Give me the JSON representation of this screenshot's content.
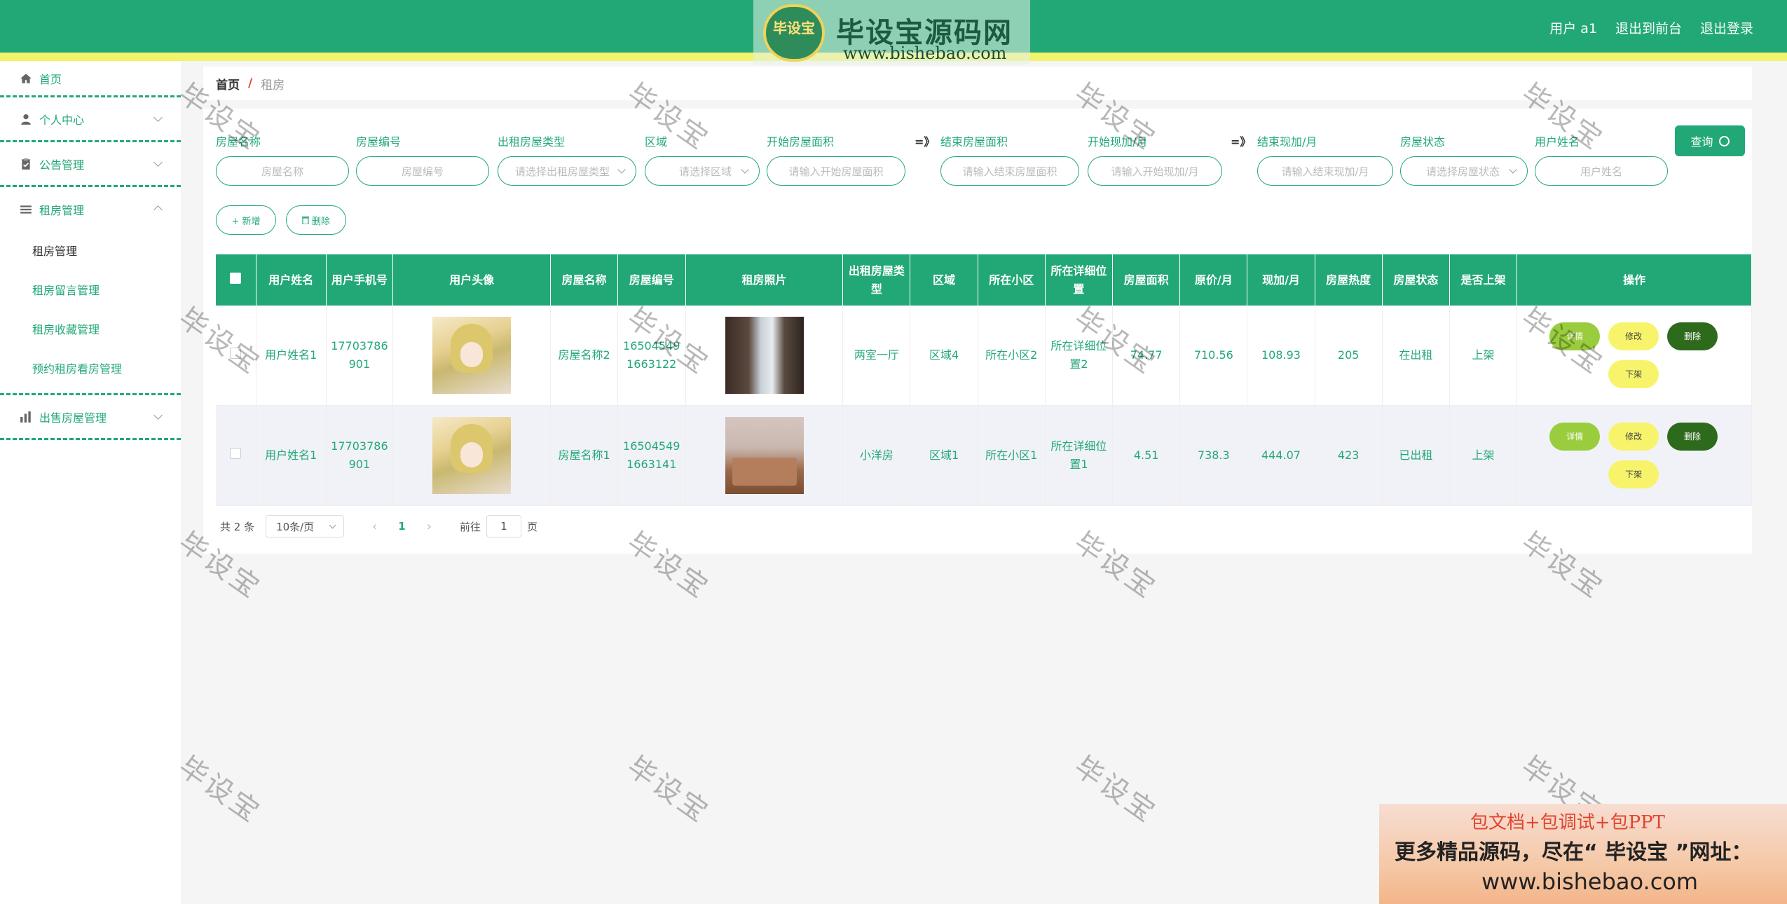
{
  "header": {
    "logo_badge": "毕设宝",
    "logo_title": "毕设宝源码网",
    "logo_url": "www.bishebao.com",
    "user": "用户 a1",
    "back_to_front": "退出到前台",
    "logout": "退出登录"
  },
  "sidebar": {
    "items": [
      {
        "label": "首页",
        "icon": "home-icon"
      },
      {
        "label": "个人中心",
        "icon": "user-icon"
      },
      {
        "label": "公告管理",
        "icon": "clipboard-icon"
      },
      {
        "label": "租房管理",
        "icon": "list-icon"
      },
      {
        "label": "出售房屋管理",
        "icon": "bar-chart-icon"
      }
    ],
    "sub": [
      "租房管理",
      "租房留言管理",
      "租房收藏管理",
      "预约租房看房管理"
    ]
  },
  "breadcrumb": {
    "home": "首页",
    "sep": "/",
    "current": "租房"
  },
  "search": {
    "fields": [
      {
        "label": "房屋名称",
        "placeholder": "房屋名称"
      },
      {
        "label": "房屋编号",
        "placeholder": "房屋编号"
      },
      {
        "label": "出租房屋类型",
        "placeholder": "请选择出租房屋类型"
      },
      {
        "label": "区域",
        "placeholder": "请选择区域"
      },
      {
        "label": "开始房屋面积",
        "placeholder": "请输入开始房屋面积"
      },
      {
        "label": "结束房屋面积",
        "placeholder": "请输入结束房屋面积"
      },
      {
        "label": "开始现加/月",
        "placeholder": "请输入开始现加/月"
      },
      {
        "label": "结束现加/月",
        "placeholder": "请输入结束现加/月"
      },
      {
        "label": "房屋状态",
        "placeholder": "请选择房屋状态"
      },
      {
        "label": "用户姓名",
        "placeholder": "用户姓名"
      }
    ],
    "range_arrow": "=》",
    "query": "查询",
    "add": "+ 新增",
    "delete": "删除"
  },
  "table": {
    "headers": [
      "用户姓名",
      "用户手机号",
      "用户头像",
      "房屋名称",
      "房屋编号",
      "租房照片",
      "出租房屋类型",
      "区域",
      "所在小区",
      "所在详细位置",
      "房屋面积",
      "原价/月",
      "现加/月",
      "房屋热度",
      "房屋状态",
      "是否上架",
      "操作"
    ],
    "rows": [
      {
        "name": "用户姓名1",
        "phone": "17703786901",
        "house": "房屋名称2",
        "code": "165045491663122",
        "type": "两室一厅",
        "area": "区域4",
        "community": "所在小区2",
        "address": "所在详细位置2",
        "size": "74.77",
        "orig": "710.56",
        "now": "108.93",
        "heat": "205",
        "status": "在出租",
        "shelf": "上架"
      },
      {
        "name": "用户姓名1",
        "phone": "17703786901",
        "house": "房屋名称1",
        "code": "165045491663141",
        "type": "小洋房",
        "area": "区域1",
        "community": "所在小区1",
        "address": "所在详细位置1",
        "size": "4.51",
        "orig": "738.3",
        "now": "444.07",
        "heat": "423",
        "status": "已出租",
        "shelf": "上架"
      }
    ],
    "ops": {
      "detail": "详情",
      "edit": "修改",
      "delete": "删除",
      "off": "下架"
    }
  },
  "pager": {
    "total": "共 2 条",
    "size": "10条/页",
    "page": "1",
    "goto": "前往",
    "goto_value": "1",
    "unit": "页"
  },
  "watermark": "毕设宝",
  "ad": {
    "line1": "包文档+包调试+包PPT",
    "line2": "更多精品源码，尽在“ 毕设宝 ”网址：",
    "line3": "www.bishebao.com"
  },
  "colors": {
    "primary": "#22a876",
    "accent_yellow": "#f1f36a",
    "danger": "#e0452f"
  }
}
